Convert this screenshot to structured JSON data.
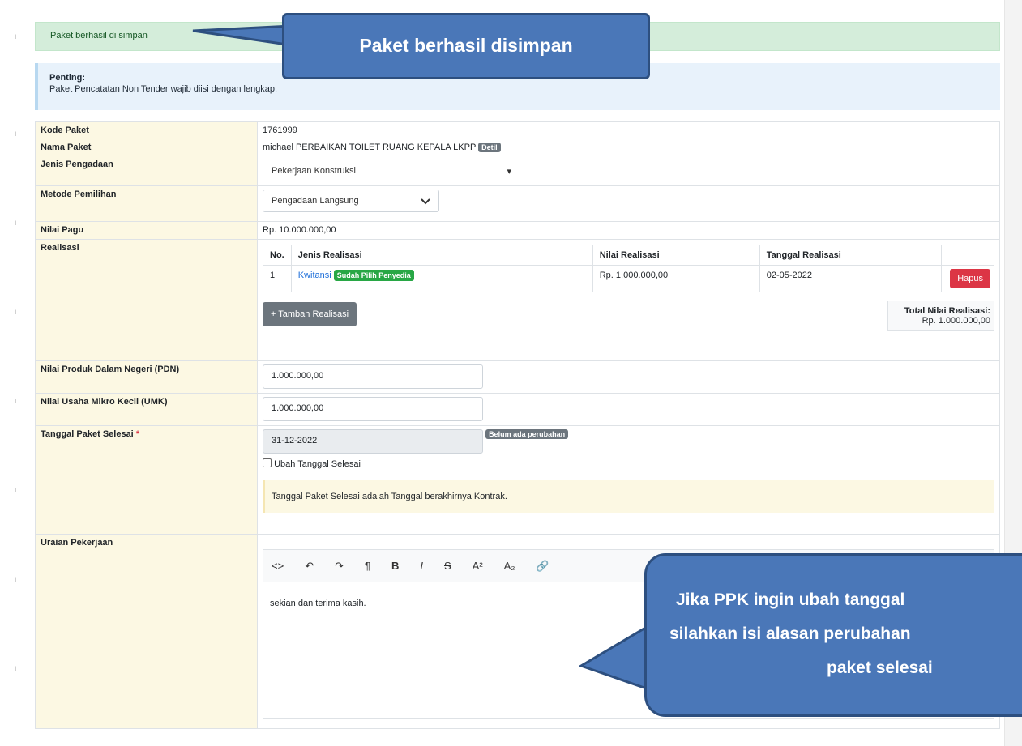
{
  "alert_success": {
    "text": "Paket berhasil di simpan"
  },
  "alert_info": {
    "title": "Penting:",
    "text": "Paket Pencatatan Non Tender wajib diisi dengan lengkap."
  },
  "form": {
    "kode_paket": {
      "label": "Kode Paket",
      "value": "1761999"
    },
    "nama_paket": {
      "label": "Nama Paket",
      "value": "michael PERBAIKAN TOILET RUANG KEPALA LKPP",
      "badge": "Detil"
    },
    "jenis_pengadaan": {
      "label": "Jenis Pengadaan",
      "value": "Pekerjaan Konstruksi"
    },
    "metode_pemilihan": {
      "label": "Metode Pemilihan",
      "value": "Pengadaan Langsung"
    },
    "nilai_pagu": {
      "label": "Nilai Pagu",
      "value": "Rp. 10.000.000,00"
    },
    "realisasi": {
      "label": "Realisasi",
      "headers": [
        "No.",
        "Jenis Realisasi",
        "Nilai Realisasi",
        "Tanggal Realisasi"
      ],
      "rows": [
        {
          "no": "1",
          "jenis": "Kwitansi",
          "badge": "Sudah Pilih Penyedia",
          "nilai": "Rp. 1.000.000,00",
          "tanggal": "02-05-2022",
          "action": "Hapus"
        }
      ],
      "add_button": "+ Tambah Realisasi",
      "total_label": "Total Nilai Realisasi:",
      "total_value": "Rp. 1.000.000,00"
    },
    "pdn": {
      "label": "Nilai Produk Dalam Negeri (PDN)",
      "value": "1.000.000,00"
    },
    "umk": {
      "label": "Nilai Usaha Mikro Kecil (UMK)",
      "value": "1.000.000,00"
    },
    "tanggal_selesai": {
      "label": "Tanggal Paket Selesai",
      "required": "*",
      "value": "31-12-2022",
      "badge": "Belum ada perubahan",
      "checkbox_label": "Ubah Tanggal Selesai",
      "note": "Tanggal Paket Selesai adalah Tanggal berakhirnya Kontrak."
    },
    "uraian": {
      "label": "Uraian Pekerjaan",
      "content": "sekian dan terima kasih."
    }
  },
  "callouts": {
    "top": "Paket berhasil disimpan",
    "bottom_line1": "Jika PPK ingin ubah tanggal",
    "bottom_line2": "silahkan isi alasan perubahan",
    "bottom_line3": "paket selesai"
  },
  "colors": {
    "callout": "#4a77b8",
    "success_bg": "#d4edda",
    "label_bg": "#fcf8e3",
    "danger": "#dc3545",
    "green": "#28a745"
  }
}
